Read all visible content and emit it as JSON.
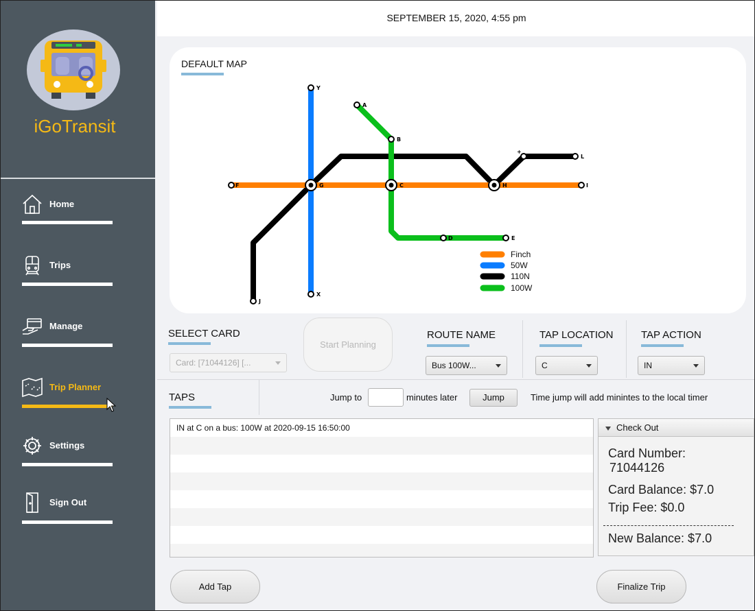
{
  "app": {
    "name": "iGoTransit"
  },
  "header": {
    "datetime": "SEPTEMBER 15, 2020, 4:55 pm"
  },
  "sidebar": {
    "items": [
      {
        "label": "Home",
        "icon": "home-icon",
        "active": false
      },
      {
        "label": "Trips",
        "icon": "train-icon",
        "active": false
      },
      {
        "label": "Manage",
        "icon": "card-hand-icon",
        "active": false
      },
      {
        "label": "Trip Planner",
        "icon": "map-icon",
        "active": true
      },
      {
        "label": "Settings",
        "icon": "gear-icon",
        "active": false
      },
      {
        "label": "Sign Out",
        "icon": "door-icon",
        "active": false
      }
    ],
    "active_color": "#f5b915"
  },
  "map": {
    "title": "DEFAULT MAP",
    "stations": [
      "Y",
      "A",
      "B",
      "L",
      "F",
      "G",
      "C",
      "H",
      "I",
      "D",
      "E",
      "J",
      "X"
    ],
    "legend": [
      {
        "label": "Finch",
        "color": "#ff7f00"
      },
      {
        "label": "50W",
        "color": "#0a7cff"
      },
      {
        "label": "110N",
        "color": "#000000"
      },
      {
        "label": "100W",
        "color": "#0bbf1c"
      }
    ]
  },
  "controls": {
    "select_card": {
      "title": "SELECT CARD",
      "value": "Card: [71044126] [..."
    },
    "start_planning": "Start Planning",
    "route_name": {
      "title": "ROUTE NAME",
      "value": "Bus 100W..."
    },
    "tap_location": {
      "title": "TAP LOCATION",
      "value": "C"
    },
    "tap_action": {
      "title": "TAP ACTION",
      "value": "IN"
    }
  },
  "taps": {
    "title": "TAPS",
    "jump_to_label": "Jump to",
    "jump_value": "",
    "minutes_later_label": "minutes later",
    "jump_button": "Jump",
    "hint": "Time jump will add minintes to the local timer",
    "rows": [
      "IN at C on a bus: 100W at 2020-09-15 16:50:00",
      "",
      "",
      "",
      "",
      "",
      "",
      ""
    ]
  },
  "checkout": {
    "title": "Check Out",
    "card_number_label": "Card Number:",
    "card_number": "71044126",
    "card_balance": "Card Balance: $7.0",
    "trip_fee": "Trip Fee:  $0.0",
    "new_balance": "New Balance:  $7.0"
  },
  "buttons": {
    "add_tap": "Add Tap",
    "finalize_trip": "Finalize Trip"
  }
}
